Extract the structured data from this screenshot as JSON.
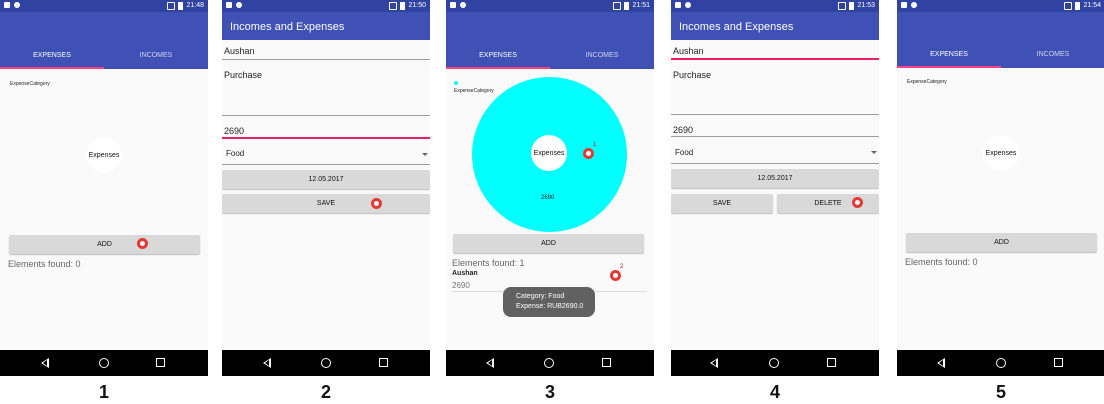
{
  "statusbar": {
    "times": [
      "21:48",
      "21:50",
      "21:51",
      "21:53",
      "21:54"
    ]
  },
  "app": {
    "title": "Incomes and Expenses",
    "tab_expenses": "EXPENSES",
    "tab_incomes": "INCOMES"
  },
  "colors": {
    "primary": "#3f51b5",
    "status": "#3043a2",
    "accent": "#ff4081",
    "pie": "#00ffff",
    "button": "#d9d9d9",
    "marker": "#e53935"
  },
  "screen1": {
    "chart_label": "ExpenseCategory",
    "center_label": "Expenses",
    "add_button": "ADD",
    "found": "Elements found: 0"
  },
  "screen2": {
    "name_value": "Aushan",
    "description_value": "Purchase",
    "amount_value": "2690",
    "category_value": "Food",
    "date_button": "12.05.2017",
    "save_button": "SAVE"
  },
  "screen3": {
    "chart_label": "ExpenseCategory",
    "center_label": "Expenses",
    "slice_value": "2690",
    "marker1": "1",
    "marker2": "2",
    "add_button": "ADD",
    "found": "Elements found: 1",
    "item_title": "Aushan",
    "item_amount": "2690",
    "toast_line1": "Category: Food",
    "toast_line2": "Expense: RUB2690.0"
  },
  "screen4": {
    "name_value": "Aushan",
    "description_value": "Purchase",
    "amount_value": "2690",
    "category_value": "Food",
    "date_button": "12.05.2017",
    "save_button": "SAVE",
    "delete_button": "DELETE"
  },
  "screen5": {
    "chart_label": "ExpenseCategory",
    "center_label": "Expenses",
    "add_button": "ADD",
    "found": "Elements found: 0"
  },
  "captions": [
    "1",
    "2",
    "3",
    "4",
    "5"
  ]
}
